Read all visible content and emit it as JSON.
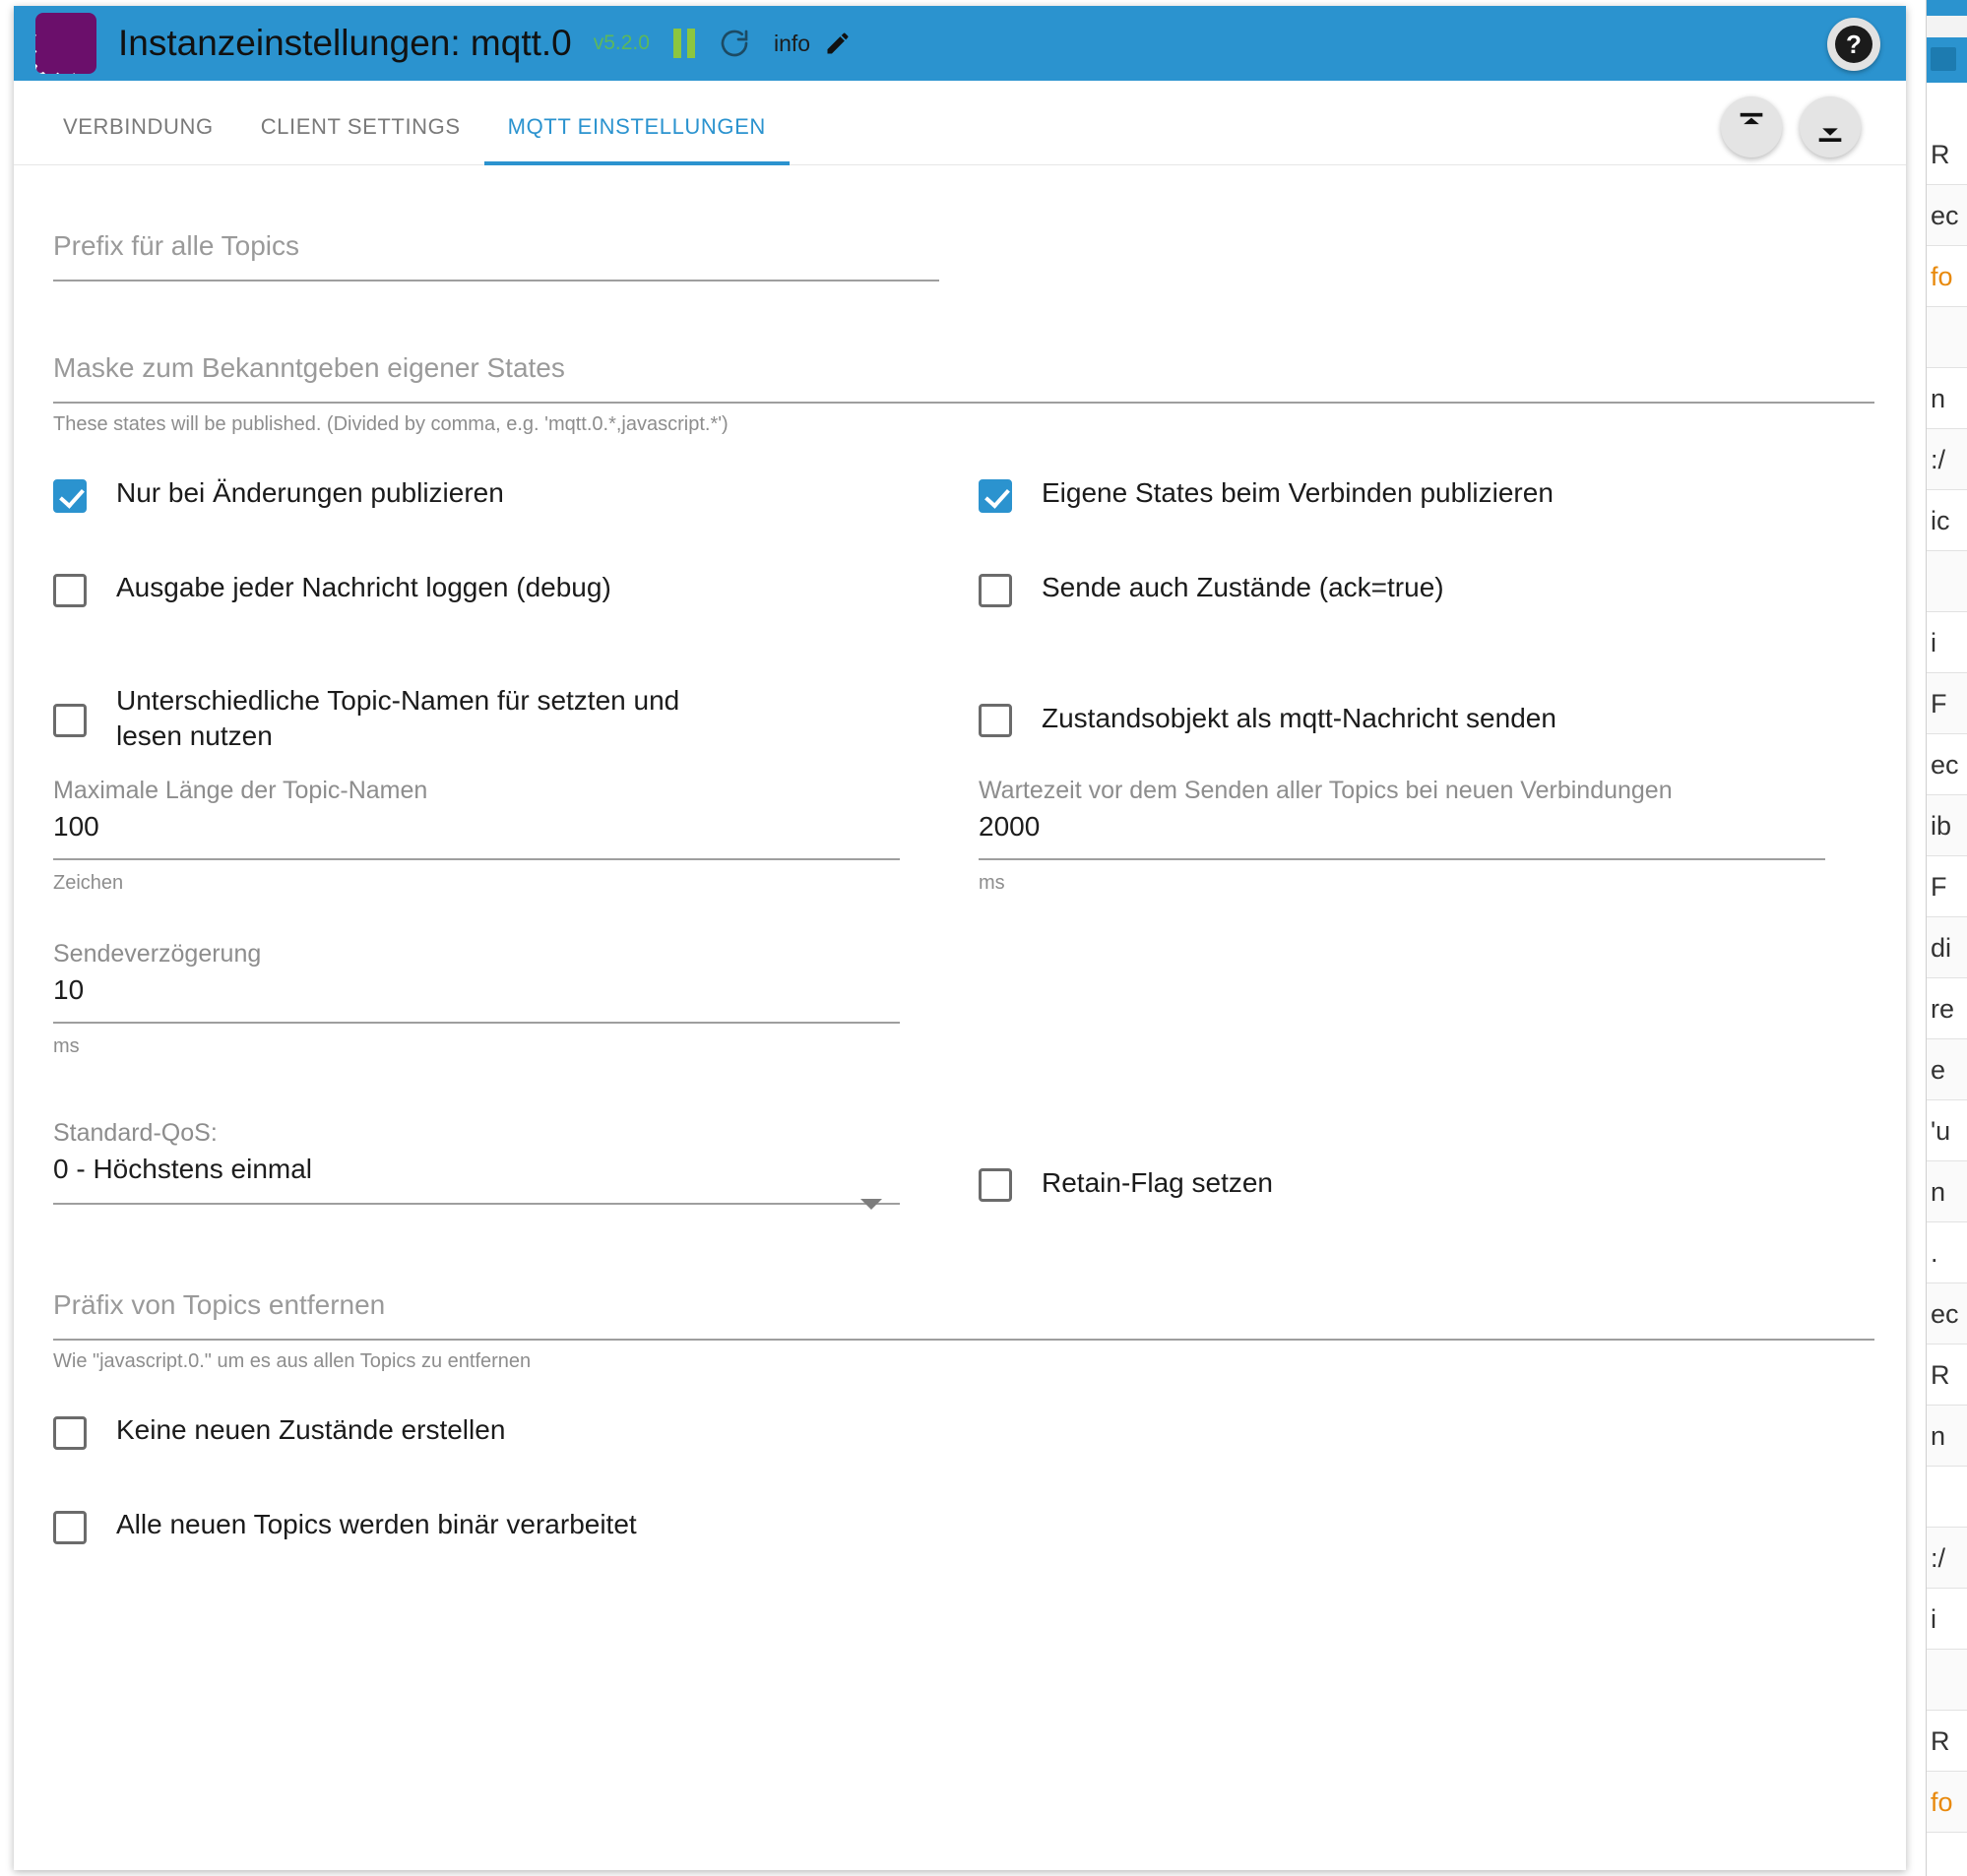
{
  "header": {
    "title": "Instanzeinstellungen: mqtt.0",
    "version": "v5.2.0",
    "pause_icon": "pause-icon",
    "refresh_icon": "refresh-icon",
    "info_label": "info",
    "edit_icon": "pencil-icon",
    "help_icon": "question-mark-icon",
    "help_label": "?",
    "logo_icon": "iobroker-logo-icon",
    "accent_color": "#2b93cf",
    "version_color": "#5cb85c"
  },
  "tabs": [
    {
      "label": "VERBINDUNG",
      "active": false
    },
    {
      "label": "CLIENT SETTINGS",
      "active": false
    },
    {
      "label": "MQTT EINSTELLUNGEN",
      "active": true
    }
  ],
  "toolbar": {
    "upload_icon": "upload-icon",
    "download_icon": "download-icon"
  },
  "form": {
    "prefix": {
      "placeholder": "Prefix für alle Topics",
      "value": ""
    },
    "mask": {
      "placeholder": "Maske zum Bekanntgeben eigener States",
      "value": "",
      "hint": "These states will be published. (Divided by comma, e.g. 'mqtt.0.*,javascript.*')"
    },
    "checkboxes": [
      {
        "label": "Nur bei Änderungen publizieren",
        "checked": true
      },
      {
        "label": "Eigene States beim Verbinden publizieren",
        "checked": true
      },
      {
        "label": "Ausgabe jeder Nachricht loggen (debug)",
        "checked": false
      },
      {
        "label": "Sende auch Zustände (ack=true)",
        "checked": false
      },
      {
        "label": "Unterschiedliche Topic-Namen für setzten und lesen nutzen",
        "checked": false
      },
      {
        "label": "Zustandsobjekt als mqtt-Nachricht senden",
        "checked": false
      }
    ],
    "max_topic_length": {
      "label": "Maximale Länge der Topic-Namen",
      "value": "100",
      "suffix": "Zeichen"
    },
    "publish_wait": {
      "label": "Wartezeit vor dem Senden aller Topics bei neuen Verbindungen",
      "value": "2000",
      "suffix": "ms"
    },
    "send_delay": {
      "label": "Sendeverzögerung",
      "value": "10",
      "suffix": "ms"
    },
    "qos": {
      "label": "Standard-QoS:",
      "value": "0 - Höchstens einmal",
      "caret_icon": "chevron-down-icon"
    },
    "retain": {
      "label": "Retain-Flag setzen",
      "checked": false
    },
    "remove_prefix": {
      "placeholder": "Präfix von Topics entfernen",
      "value": "",
      "hint": "Wie \"javascript.0.\" um es aus allen Topics zu entfernen"
    },
    "bottom_checkboxes": [
      {
        "label": "Keine neuen Zustände erstellen",
        "checked": false
      },
      {
        "label": "Alle neuen Topics werden binär verarbeitet",
        "checked": false
      }
    ]
  },
  "background_window": {
    "rows": [
      "R",
      "ec",
      "fo",
      "",
      "n",
      ":/",
      "ic",
      "",
      "i",
      "F",
      "ec",
      "ib",
      "F",
      "di",
      "re",
      "e",
      "'u",
      "n",
      ".",
      "ec",
      "R",
      "n",
      "",
      ":/",
      "i",
      "",
      "R",
      "fo"
    ],
    "link_indices": [
      2,
      27
    ]
  }
}
